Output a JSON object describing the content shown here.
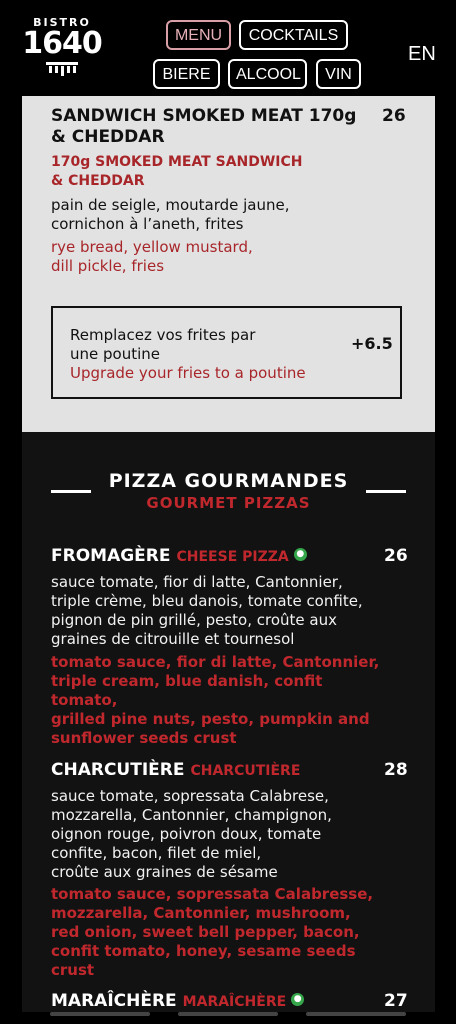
{
  "header": {
    "logo_small": "BISTRO",
    "logo_big": "1640",
    "nav": [
      {
        "label": "MENU",
        "active": true
      },
      {
        "label": "COCKTAILS"
      },
      {
        "label": "BIERE"
      },
      {
        "label": "ALCOOL"
      },
      {
        "label": "VIN"
      }
    ],
    "lang": "EN"
  },
  "sandwich": {
    "title": "SANDWICH SMOKED MEAT 170g & CHEDDAR",
    "title_lines": [
      "SANDWICH SMOKED MEAT 170g",
      "& CHEDDAR"
    ],
    "price": "26",
    "subtitle_lines": [
      "170g SMOKED MEAT SANDWICH",
      "& CHEDDAR"
    ],
    "desc_fr_lines": [
      "pain de seigle, moutarde jaune,",
      "cornichon à l’aneth, frites"
    ],
    "desc_en_lines": [
      "rye bread, yellow mustard,",
      "dill pickle, fries"
    ],
    "upgrade": {
      "fr_lines": [
        "Remplacez vos frites par",
        "une poutine"
      ],
      "en": "Upgrade your fries to a poutine",
      "price": "+6.5"
    }
  },
  "section": {
    "title": "PIZZA GOURMANDES",
    "subtitle": "GOURMET PIZZAS"
  },
  "pizzas": [
    {
      "name": "FROMAGÈRE",
      "name_en": "CHEESE PIZZA",
      "vegetarian": true,
      "price": "26",
      "fr_lines": [
        "sauce tomate, fior di latte, Cantonnier,",
        "triple crème, bleu danois, tomate confite,",
        "pignon de pin grillé, pesto, croûte aux",
        "graines de citrouille et tournesol"
      ],
      "en_lines": [
        "tomato sauce, fior di latte, Cantonnier,",
        "triple cream, blue danish, confit tomato,",
        "grilled pine nuts, pesto, pumpkin and",
        "sunflower seeds crust"
      ]
    },
    {
      "name": "CHARCUTIÈRE",
      "name_en": "CHARCUTIÈRE",
      "vegetarian": false,
      "price": "28",
      "fr_lines": [
        "sauce tomate, sopressata Calabrese,",
        "mozzarella, Cantonnier, champignon,",
        "oignon rouge, poivron doux, tomate",
        "confite, bacon, filet de miel,",
        "croûte aux graines de sésame"
      ],
      "en_lines": [
        "tomato sauce, sopressata Calabresse,",
        "mozzarella, Cantonnier, mushroom,",
        "red onion, sweet bell pepper, bacon,",
        "confit tomato, honey, sesame seeds crust"
      ]
    },
    {
      "name": "MARAÎCHÈRE",
      "name_en": "MARAÎCHÈRE",
      "vegetarian": true,
      "price": "27"
    }
  ],
  "colors": {
    "accent_red": "#c0282d",
    "card_bg": "#e2e2e2",
    "veg_green": "#35a64a"
  }
}
